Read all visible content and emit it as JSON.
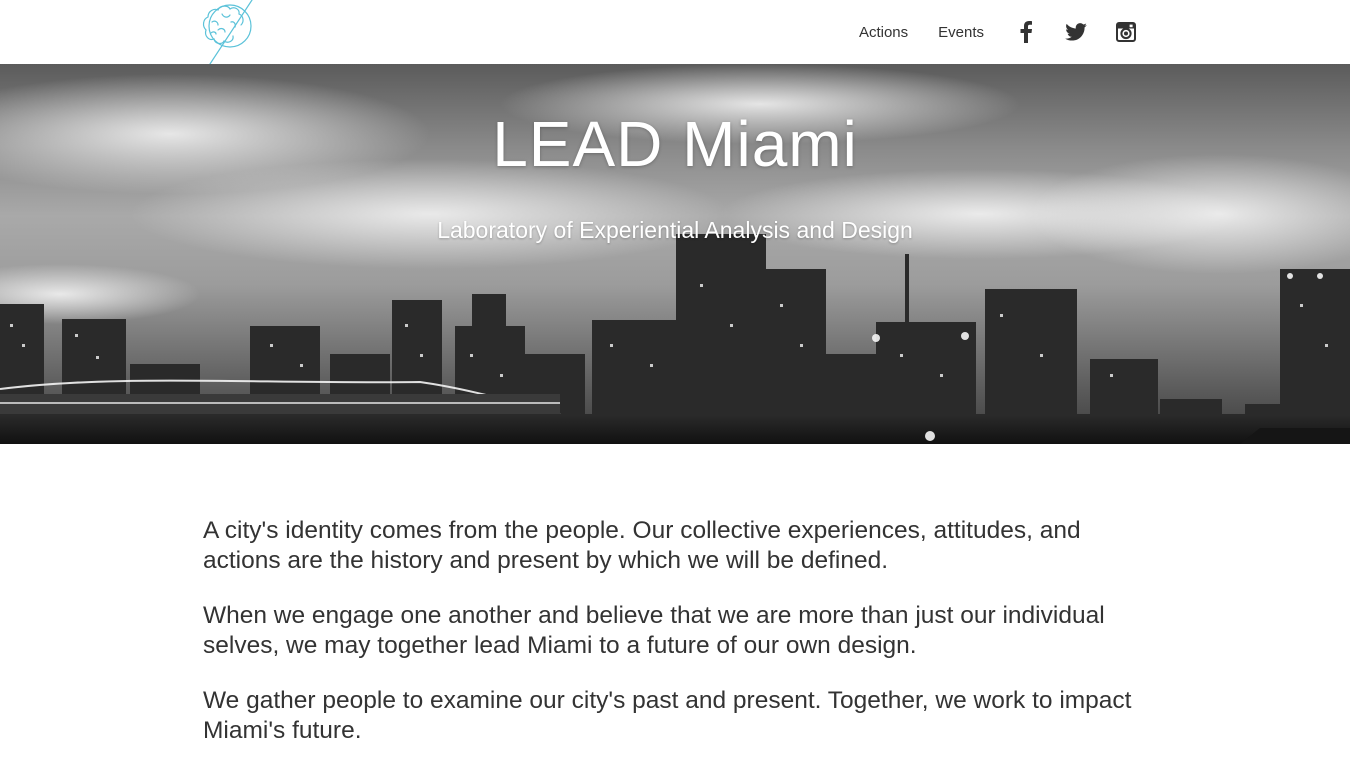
{
  "header": {
    "logo_icon": "brain-logo-icon",
    "nav": [
      {
        "label": "Actions"
      },
      {
        "label": "Events"
      }
    ],
    "social": [
      {
        "icon": "facebook-icon"
      },
      {
        "icon": "twitter-icon"
      },
      {
        "icon": "instagram-icon"
      }
    ],
    "accent_color": "#5bc2d9"
  },
  "hero": {
    "title": "LEAD Miami",
    "subtitle": "Laboratory of Experiential Analysis and Design",
    "background": "grayscale-miami-skyline"
  },
  "content": {
    "paragraphs": [
      "A city's identity comes from the people. Our collective experiences, attitudes, and actions are the history and present by which we will be defined.",
      "When we engage one another and believe that we are more than just our individual selves, we may together lead Miami to a future of our own design.",
      "We gather people to examine our city's past and present. Together, we work to impact Miami's future."
    ]
  }
}
